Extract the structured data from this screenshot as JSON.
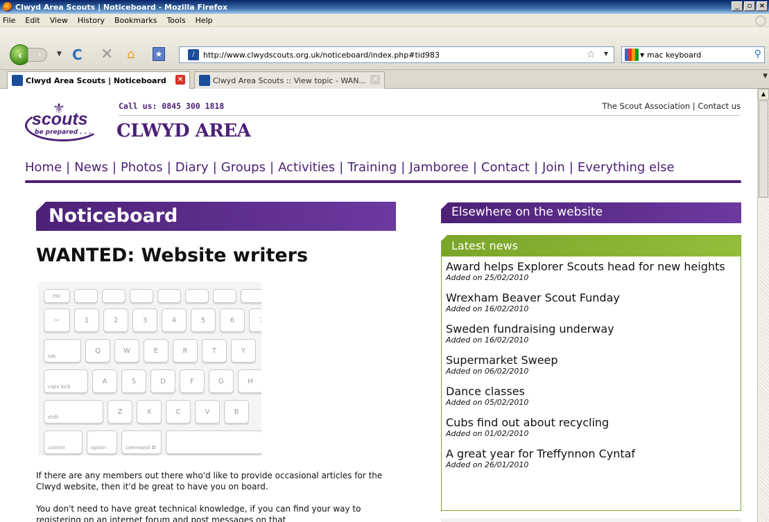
{
  "window": {
    "title": "Clwyd Area Scouts | Noticeboard - Mozilla Firefox",
    "controls": [
      "_",
      "5",
      "X"
    ]
  },
  "menu": [
    "File",
    "Edit",
    "View",
    "History",
    "Bookmarks",
    "Tools",
    "Help"
  ],
  "browser": {
    "url": "http://www.clwydscouts.org.uk/noticeboard/index.php#tid983",
    "search_value": "mac keyboard",
    "tabs": [
      {
        "label": "Clwyd Area Scouts | Noticeboard",
        "active": true
      },
      {
        "label": "Clwyd Area Scouts :: View topic - WAN...",
        "active": false
      }
    ]
  },
  "site": {
    "logo_text": "scouts",
    "logo_tagline": "be prepared . . .",
    "call_us": "Call us:  0845 300 1818",
    "area_title": "CLWYD AREA",
    "top_links": [
      "The Scout Association",
      "Contact us"
    ],
    "nav": [
      "Home",
      "News",
      "Photos",
      "Diary",
      "Groups",
      "Activities",
      "Training",
      "Jamboree",
      "Contact",
      "Join",
      "Everything else"
    ]
  },
  "main": {
    "section_title": "Noticeboard",
    "article_title": "WANTED: Website writers",
    "paragraphs": [
      "If there are any members out there who'd like to provide occasional articles for the Clwyd website, then it'd be great to have you on board.",
      "You don't need to have great technical knowledge, if you can find your way to registering on an internet forum and post messages on that"
    ]
  },
  "sidebar": {
    "heading": "Elsewhere on the website",
    "news_heading": "Latest news",
    "news": [
      {
        "title": "Award helps Explorer Scouts head for new heights",
        "date": "Added on 25/02/2010"
      },
      {
        "title": "Wrexham Beaver Scout Funday",
        "date": "Added on 16/02/2010"
      },
      {
        "title": "Sweden fundraising underway",
        "date": "Added on 16/02/2010"
      },
      {
        "title": "Supermarket Sweep",
        "date": "Added on 06/02/2010"
      },
      {
        "title": "Dance classes",
        "date": "Added on 05/02/2010"
      },
      {
        "title": "Cubs find out about recycling",
        "date": "Added on 01/02/2010"
      },
      {
        "title": "A great year for Treffynnon Cyntaf",
        "date": "Added on 26/01/2010"
      }
    ]
  },
  "keyboard_keys": {
    "row0": [
      "esc",
      "",
      "",
      "",
      "",
      "",
      ""
    ],
    "row1": [
      "~",
      "!",
      "@",
      "#",
      "$",
      "%",
      "^",
      "&"
    ],
    "row1_sub": [
      "`",
      "1",
      "2",
      "3",
      "4",
      "5",
      "6",
      "7"
    ],
    "row2": [
      "tab",
      "Q",
      "W",
      "E",
      "R",
      "T",
      "Y"
    ],
    "row3": [
      "caps lock",
      "A",
      "S",
      "D",
      "F",
      "G",
      "H"
    ],
    "row4": [
      "shift",
      "Z",
      "X",
      "C",
      "V",
      "B"
    ],
    "row5": [
      "control",
      "option",
      "command ⌘"
    ]
  }
}
